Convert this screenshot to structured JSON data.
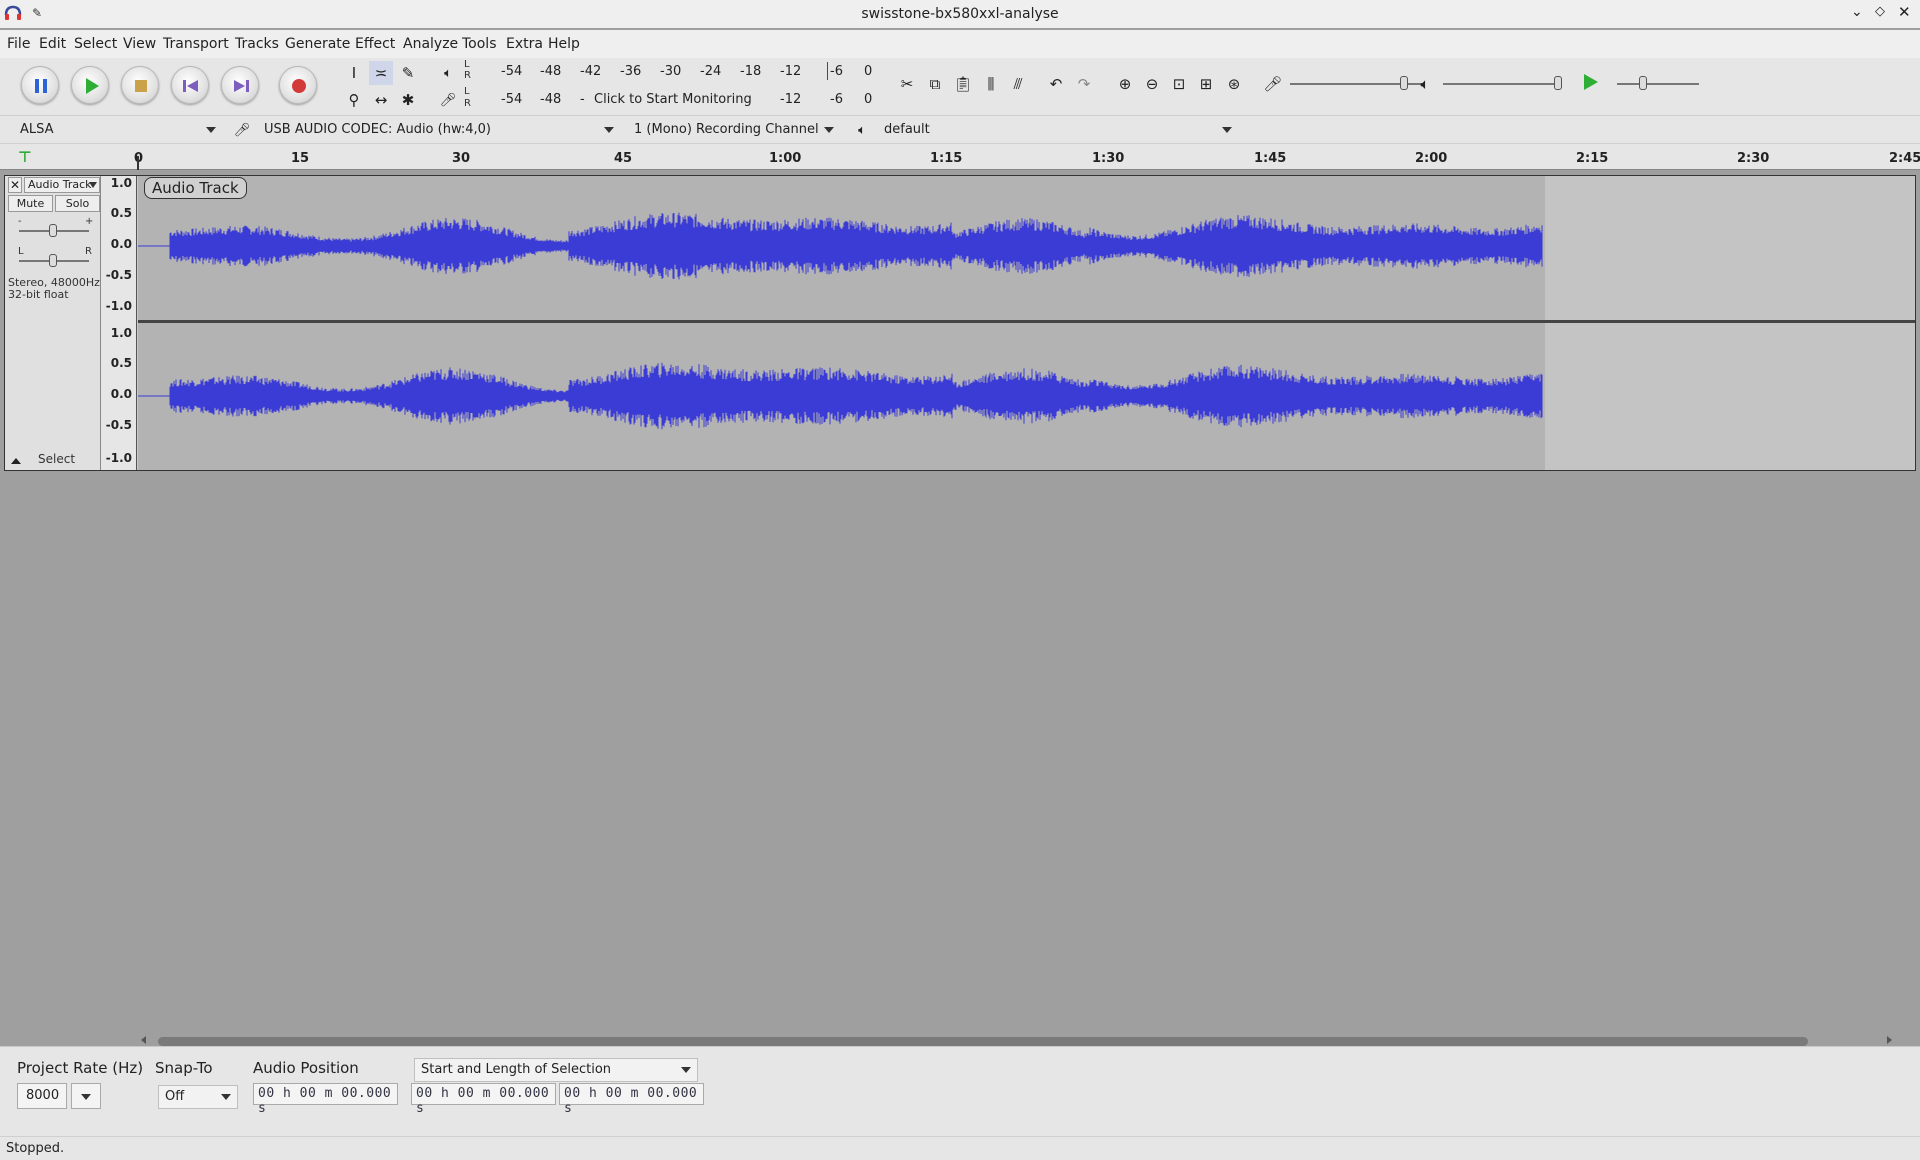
{
  "window": {
    "title": "swisstone-bx580xxl-analyse"
  },
  "menu": [
    "File",
    "Edit",
    "Select",
    "View",
    "Transport",
    "Tracks",
    "Generate",
    "Effect",
    "Analyze",
    "Tools",
    "Extra",
    "Help"
  ],
  "meters": {
    "record_scale": [
      "-54",
      "-48",
      "-42",
      "-36",
      "-30",
      "-24",
      "-18",
      "-12",
      "-6",
      "0"
    ],
    "play_scale_left": [
      "-54",
      "-48",
      "-"
    ],
    "play_prompt": "Click to Start Monitoring",
    "play_scale_right": [
      "-12",
      "-6",
      "0"
    ],
    "L": "L",
    "R": "R"
  },
  "device": {
    "host": "ALSA",
    "recording_device": "USB AUDIO  CODEC: Audio (hw:4,0)",
    "channels": "1 (Mono) Recording Channel",
    "playback_device": "default"
  },
  "ruler": {
    "ticks": [
      "0",
      "15",
      "30",
      "45",
      "1:00",
      "1:15",
      "1:30",
      "1:45",
      "2:00",
      "2:15",
      "2:30",
      "2:45"
    ]
  },
  "track": {
    "name": "Audio Track",
    "menu_label": "Audio Track",
    "mute": "Mute",
    "solo": "Solo",
    "info_line1": "Stereo, 48000Hz",
    "info_line2": "32-bit float",
    "select": "Select",
    "gain_minus": "-",
    "gain_plus": "+",
    "pan_left": "L",
    "pan_right": "R",
    "scale": [
      "1.0",
      "0.5",
      "0.0",
      "-0.5",
      "-1.0"
    ],
    "waveform_color": "#3b3bd6"
  },
  "selection_bar": {
    "project_rate_label": "Project Rate (Hz)",
    "project_rate_value": "8000",
    "snap_to_label": "Snap-To",
    "snap_to_value": "Off",
    "audio_position_label": "Audio Position",
    "selection_mode": "Start and Length of Selection",
    "audio_position": "00 h 00 m 00.000 s",
    "selection_start": "00 h 00 m 00.000 s",
    "selection_length": "00 h 00 m 00.000 s"
  },
  "status": {
    "text": "Stopped."
  }
}
